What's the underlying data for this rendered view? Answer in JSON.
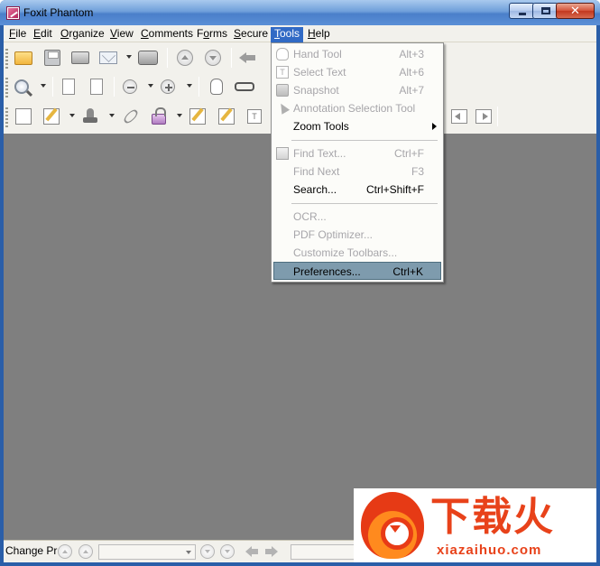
{
  "window": {
    "title": "Foxit Phantom",
    "close_glyph": "✕"
  },
  "menubar": {
    "items": [
      {
        "pre": "",
        "u": "F",
        "post": "ile"
      },
      {
        "pre": "",
        "u": "E",
        "post": "dit"
      },
      {
        "pre": "",
        "u": "O",
        "post": "rganize"
      },
      {
        "pre": "",
        "u": "V",
        "post": "iew"
      },
      {
        "pre": "",
        "u": "C",
        "post": "omments"
      },
      {
        "pre": "F",
        "u": "o",
        "post": "rms"
      },
      {
        "pre": "",
        "u": "S",
        "post": "ecure"
      },
      {
        "pre": "",
        "u": "T",
        "post": "ools"
      },
      {
        "pre": "",
        "u": "H",
        "post": "elp"
      }
    ]
  },
  "tools_menu": {
    "items": [
      {
        "label": "Hand Tool",
        "shortcut": "Alt+3",
        "enabled": false,
        "icon": "hand-icon"
      },
      {
        "label": "Select Text",
        "shortcut": "Alt+6",
        "enabled": false,
        "icon": "text-select-icon"
      },
      {
        "label": "Snapshot",
        "shortcut": "Alt+7",
        "enabled": false,
        "icon": "camera-icon"
      },
      {
        "label": "Annotation Selection Tool",
        "shortcut": "",
        "enabled": false,
        "icon": "pointer-arrow-icon"
      },
      {
        "label": "Zoom Tools",
        "shortcut": "",
        "enabled": true,
        "submenu": true
      },
      {
        "label": "Find Text...",
        "shortcut": "Ctrl+F",
        "enabled": false,
        "icon": "find-icon"
      },
      {
        "label": "Find Next",
        "shortcut": "F3",
        "enabled": false
      },
      {
        "label": "Search...",
        "shortcut": "Ctrl+Shift+F",
        "enabled": true
      },
      {
        "label": "OCR...",
        "shortcut": "",
        "enabled": false
      },
      {
        "label": "PDF Optimizer...",
        "shortcut": "",
        "enabled": false
      },
      {
        "label": "Customize Toolbars...",
        "shortcut": "",
        "enabled": false
      },
      {
        "label": "Preferences...",
        "shortcut": "Ctrl+K",
        "enabled": true,
        "selected": true
      }
    ]
  },
  "statusbar": {
    "text": "Change Pr"
  },
  "watermark": {
    "chinese": "下载火",
    "url": "xiazaihuo.com"
  },
  "colors": {
    "titlebar": "#4a7fca",
    "menu_highlight": "#316ac5",
    "selected_item": "#7e9bad",
    "workspace": "#7f7f7f",
    "chrome": "#f2f1ec",
    "watermark_red": "#e8421a"
  }
}
